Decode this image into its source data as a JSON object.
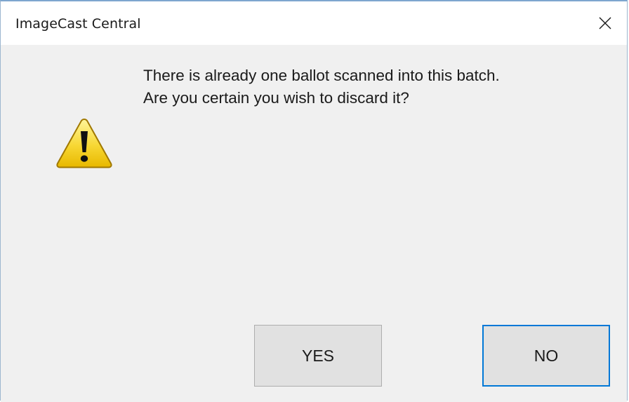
{
  "window": {
    "title": "ImageCast Central"
  },
  "titlebar": {
    "close_icon": "close-icon"
  },
  "message": {
    "line1": "There is already one ballot scanned into this batch.",
    "line2": "Are you certain you wish to discard it?",
    "icon": "warning-icon"
  },
  "buttons": {
    "yes_label": "YES",
    "no_label": "NO",
    "default_button": "NO"
  },
  "colors": {
    "dialog_background": "#f0f0f0",
    "titlebar_background": "#ffffff",
    "button_background": "#e1e1e1",
    "focus_border": "#0078d7",
    "warning_fill": "#f7d733"
  }
}
